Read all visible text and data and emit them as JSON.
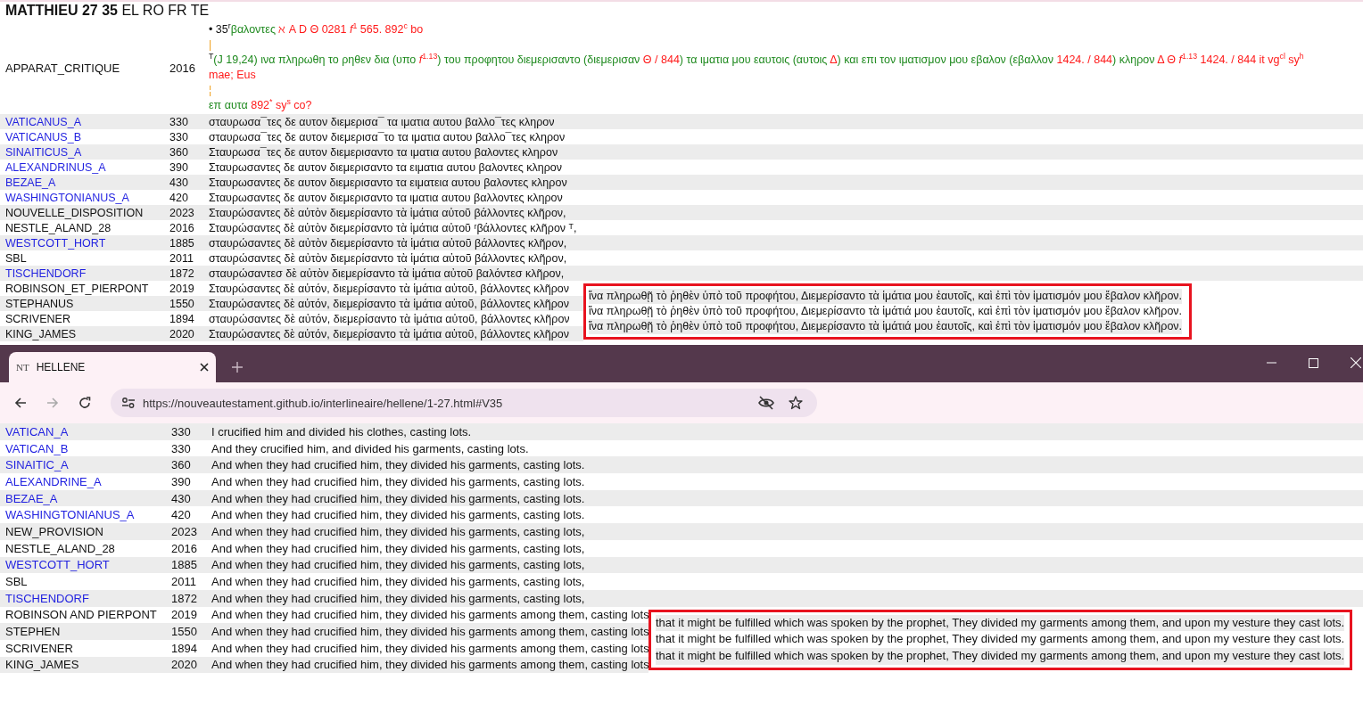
{
  "heading": "**MATTHIEU 27 35** EL RO FR TE",
  "apparatus": {
    "name": "APPARAT_CRITIQUE",
    "year": "2016",
    "lines": [
      [
        {
          "kind": "mark",
          "text": "• 35$^{r}$"
        },
        {
          "kind": "lemma",
          "text": "βαλοντες"
        },
        {
          "kind": "witness",
          "text": " ℵ A D Θ 0281 *f*$^{1}$ 565. 892$^{c}$ bo"
        }
      ],
      [
        {
          "kind": "separator",
          "text": "|"
        }
      ],
      [
        {
          "kind": "mark",
          "text": "$^{T}$"
        },
        {
          "kind": "lemma",
          "text": "(J 19,24) ινα πληρωθη το ρηθεν δια (υπο "
        },
        {
          "kind": "witness",
          "text": "*f*$^{1.13}$"
        },
        {
          "kind": "lemma",
          "text": ") του προφητου διεμερισαντο (διεμερισαν "
        },
        {
          "kind": "witness",
          "text": "Θ / 844"
        },
        {
          "kind": "lemma",
          "text": ") τα ιματια μου εαυτοις (αυτοις "
        },
        {
          "kind": "witness",
          "text": "Δ"
        },
        {
          "kind": "lemma",
          "text": ") και επι τον ιματισμον μου εβαλον (εβαλλον "
        },
        {
          "kind": "witness",
          "text": "1424. / 844"
        },
        {
          "kind": "lemma",
          "text": ") κληρον "
        },
        {
          "kind": "witness",
          "text": "Δ Θ *f*$^{1.13}$ 1424. / 844 it vg$^{cl}$ sy$^{h}$ mae; Eus"
        }
      ],
      [
        {
          "kind": "separator",
          "text": "¦"
        }
      ],
      [
        {
          "kind": "lemma",
          "text": "επ αυτα "
        },
        {
          "kind": "witness",
          "text": "892$^{*}$ sy$^{s}$ co?"
        }
      ]
    ]
  },
  "rows": [
    {
      "name": "VATICANUS_A",
      "link": true,
      "year": "330",
      "text": "σταυρωσα¯τες δε αυτον διεμερισα¯ τα ιματια αυτου βαλλο¯τες κληρον"
    },
    {
      "name": "VATICANUS_B",
      "link": true,
      "year": "330",
      "text": "σταυρωσα¯τες δε αυτον διεμερισα¯το τα ιματια αυτου βαλλο¯τες κληρον"
    },
    {
      "name": "SINAITICUS_A",
      "link": true,
      "year": "360",
      "text": "Σταυρωσα¯τες δε αυτον διεμερισαντο τα ιματια αυτου βαλοντες κληρον"
    },
    {
      "name": "ALEXANDRINUS_A",
      "link": true,
      "year": "390",
      "text": "Σταυρωσαντες δε αυτον διεμερισαντο τα ειματια αυτου βαλοντες κληρον"
    },
    {
      "name": "BEZAE_A",
      "link": true,
      "year": "430",
      "text": "Σταυρωσαντες δε αυτον διεμερισαντο τα ειματεια αυτου βαλοντες κληρον"
    },
    {
      "name": "WASHINGTONIANUS_A",
      "link": true,
      "year": "420",
      "text": "Σταυρωσαντες δε αυτον διεμερισαντο τα ιματια αυτου βαλλοντες κληρον"
    },
    {
      "name": "NOUVELLE_DISPOSITION",
      "link": false,
      "year": "2023",
      "text": "Σταυρώσαντες δὲ αὐτὸν διεμερίσαντο τὰ ἱμάτια αὐτοῦ βάλλοντες κλῆρον,"
    },
    {
      "name": "NESTLE_ALAND_28",
      "link": false,
      "year": "2016",
      "text": "Σταυρώσαντες δὲ αὐτὸν διεμερίσαντο τὰ ἱμάτια αὐτοῦ ʳβάλλοντες κλῆρον ᵀ,"
    },
    {
      "name": "WESTCOTT_HORT",
      "link": true,
      "year": "1885",
      "text": "σταυρώσαντες δὲ αὐτὸν διεμερίσαντο τὰ ἱμάτια αὐτοῦ βάλλοντες κλῆρον,"
    },
    {
      "name": "SBL",
      "link": false,
      "year": "2011",
      "text": "σταυρώσαντες δὲ αὐτὸν διεμερίσαντο τὰ ἱμάτια αὐτοῦ βάλλοντες κλῆρον,"
    },
    {
      "name": "TISCHENDORF",
      "link": true,
      "year": "1872",
      "text": "σταυρώσαντεσ δὲ αὐτὸν διεμερίσαντο τὰ ἱμάτια αὐτοῦ βαλόντεσ κλῆρον,"
    },
    {
      "name": "ROBINSON_ET_PIERPONT",
      "link": false,
      "year": "2019",
      "text": "Σταυρώσαντες δὲ αὐτόν, διεμερίσαντο τὰ ἱμάτια αὐτοῦ, βάλλοντες κλῆρον"
    },
    {
      "name": "STEPHANUS",
      "link": false,
      "year": "1550",
      "text": "Σταυρώσαντες δὲ αὐτόν, διεμερίσαντο τὰ ἱμάτια αὐτοῦ, βάλλοντες κλῆρον",
      "addition": "ἵνα πληρωθῇ τὸ ῥηθὲν ὑπὸ τοῦ προφήτου, Διεμερίσαντο τὰ ἱμάτια μου ἑαυτοῖς, καὶ ἐπὶ τὸν ἱματισμόν μου ἔβαλον κλῆρον."
    },
    {
      "name": "SCRIVENER",
      "link": false,
      "year": "1894",
      "text": "σταυρώσαντες δὲ αὐτόν, διεμερίσαντο τὰ ἱμάτια αὐτοῦ, βάλλοντες κλῆρον",
      "addition": "ἵνα πληρωθῇ τὸ ῥηθὲν ὑπὸ τοῦ προφήτου, Διεμερίσαντο τὰ ἱμάτιά μου ἑαυτοῖς, καὶ ἐπὶ τὸν ἱματισμόν μου ἔβαλον κλῆρον."
    },
    {
      "name": "KING_JAMES",
      "link": false,
      "year": "2020",
      "text": "Σταυρώσαντες δὲ αὐτόν, διεμερίσαντο τὰ ἱμάτια αὐτοῦ, βάλλοντες κλῆρον",
      "addition": "ἵνα πληρωθῇ τὸ ῥηθὲν ὑπὸ τοῦ προφήτου, Διεμερίσαντο τὰ ἱμάτιά μου ἑαυτοῖς, καὶ ἐπὶ τὸν ἱματισμόν μου ἔβαλον κλῆρον."
    }
  ],
  "browser": {
    "tab": {
      "favicon": "NT",
      "title": "HELLENE",
      "selected": true
    },
    "url": "https://nouveautestament.github.io/interlineaire/hellene/1-27.html#V35",
    "rows": [
      {
        "name": "VATICAN_A",
        "link": true,
        "year": "330",
        "text": "I crucified him and divided his clothes, casting lots."
      },
      {
        "name": "VATICAN_B",
        "link": true,
        "year": "330",
        "text": "And they crucified him, and divided his garments, casting lots."
      },
      {
        "name": "SINAITIC_A",
        "link": true,
        "year": "360",
        "text": "And when they had crucified him, they divided his garments, casting lots."
      },
      {
        "name": "ALEXANDRINE_A",
        "link": true,
        "year": "390",
        "text": "And when they had crucified him, they divided his garments, casting lots."
      },
      {
        "name": "BEZAE_A",
        "link": true,
        "year": "430",
        "text": "And when they had crucified him, they divided his garments, casting lots."
      },
      {
        "name": "WASHINGTONIANUS_A",
        "link": true,
        "year": "420",
        "text": "And when they had crucified him, they divided his garments, casting lots."
      },
      {
        "name": "NEW_PROVISION",
        "link": false,
        "year": "2023",
        "text": "And when they had crucified him, they divided his garments, casting lots,"
      },
      {
        "name": "NESTLE_ALAND_28",
        "link": false,
        "year": "2016",
        "text": "And when they had crucified him, they divided his garments, casting lots,"
      },
      {
        "name": "WESTCOTT_HORT",
        "link": true,
        "year": "1885",
        "text": "And when they had crucified him, they divided his garments, casting lots,"
      },
      {
        "name": "SBL",
        "link": false,
        "year": "2011",
        "text": "And when they had crucified him, they divided his garments, casting lots,"
      },
      {
        "name": "TISCHENDORF",
        "link": true,
        "year": "1872",
        "text": "And when they had crucified him, they divided his garments, casting lots,"
      },
      {
        "name": "ROBINSON AND PIERPONT",
        "link": false,
        "year": "2019",
        "text": "And when they had crucified him, they divided his garments among them, casting lots"
      },
      {
        "name": "STEPHEN",
        "link": false,
        "year": "1550",
        "text": "And when they had crucified him, they divided his garments among them, casting lots",
        "addition": "that it might be fulfilled which was spoken by the prophet, They divided my garments among them, and upon my vesture they cast lots."
      },
      {
        "name": "SCRIVENER",
        "link": false,
        "year": "1894",
        "text": "And when they had crucified him, they divided his garments among them, casting lots",
        "addition": "that it might be fulfilled which was spoken by the prophet, They divided my garments among them, and upon my vesture they cast lots."
      },
      {
        "name": "KING_JAMES",
        "link": false,
        "year": "2020",
        "text": "And when they had crucified him, they divided his garments among them, casting lots",
        "addition": "that it might be fulfilled which was spoken by the prophet, They divided my garments among them, and upon my vesture they cast lots."
      }
    ]
  }
}
